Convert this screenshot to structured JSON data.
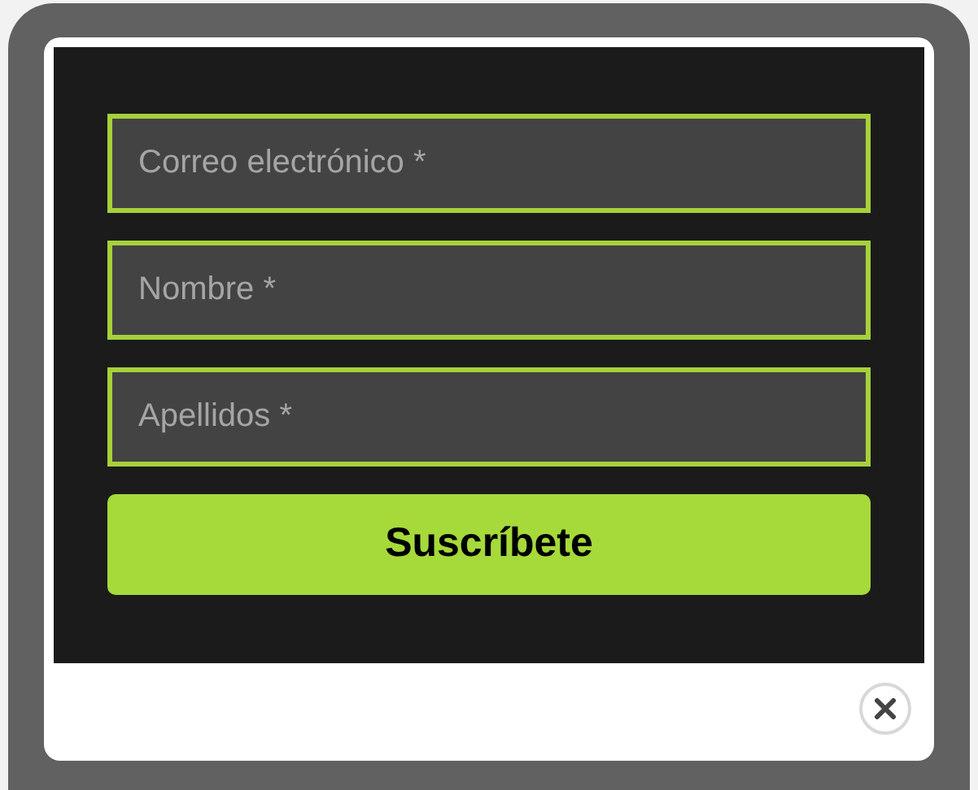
{
  "form": {
    "fields": [
      {
        "placeholder": "Correo electrónico *"
      },
      {
        "placeholder": "Nombre *"
      },
      {
        "placeholder": "Apellidos *"
      }
    ],
    "submit": "Suscríbete"
  }
}
